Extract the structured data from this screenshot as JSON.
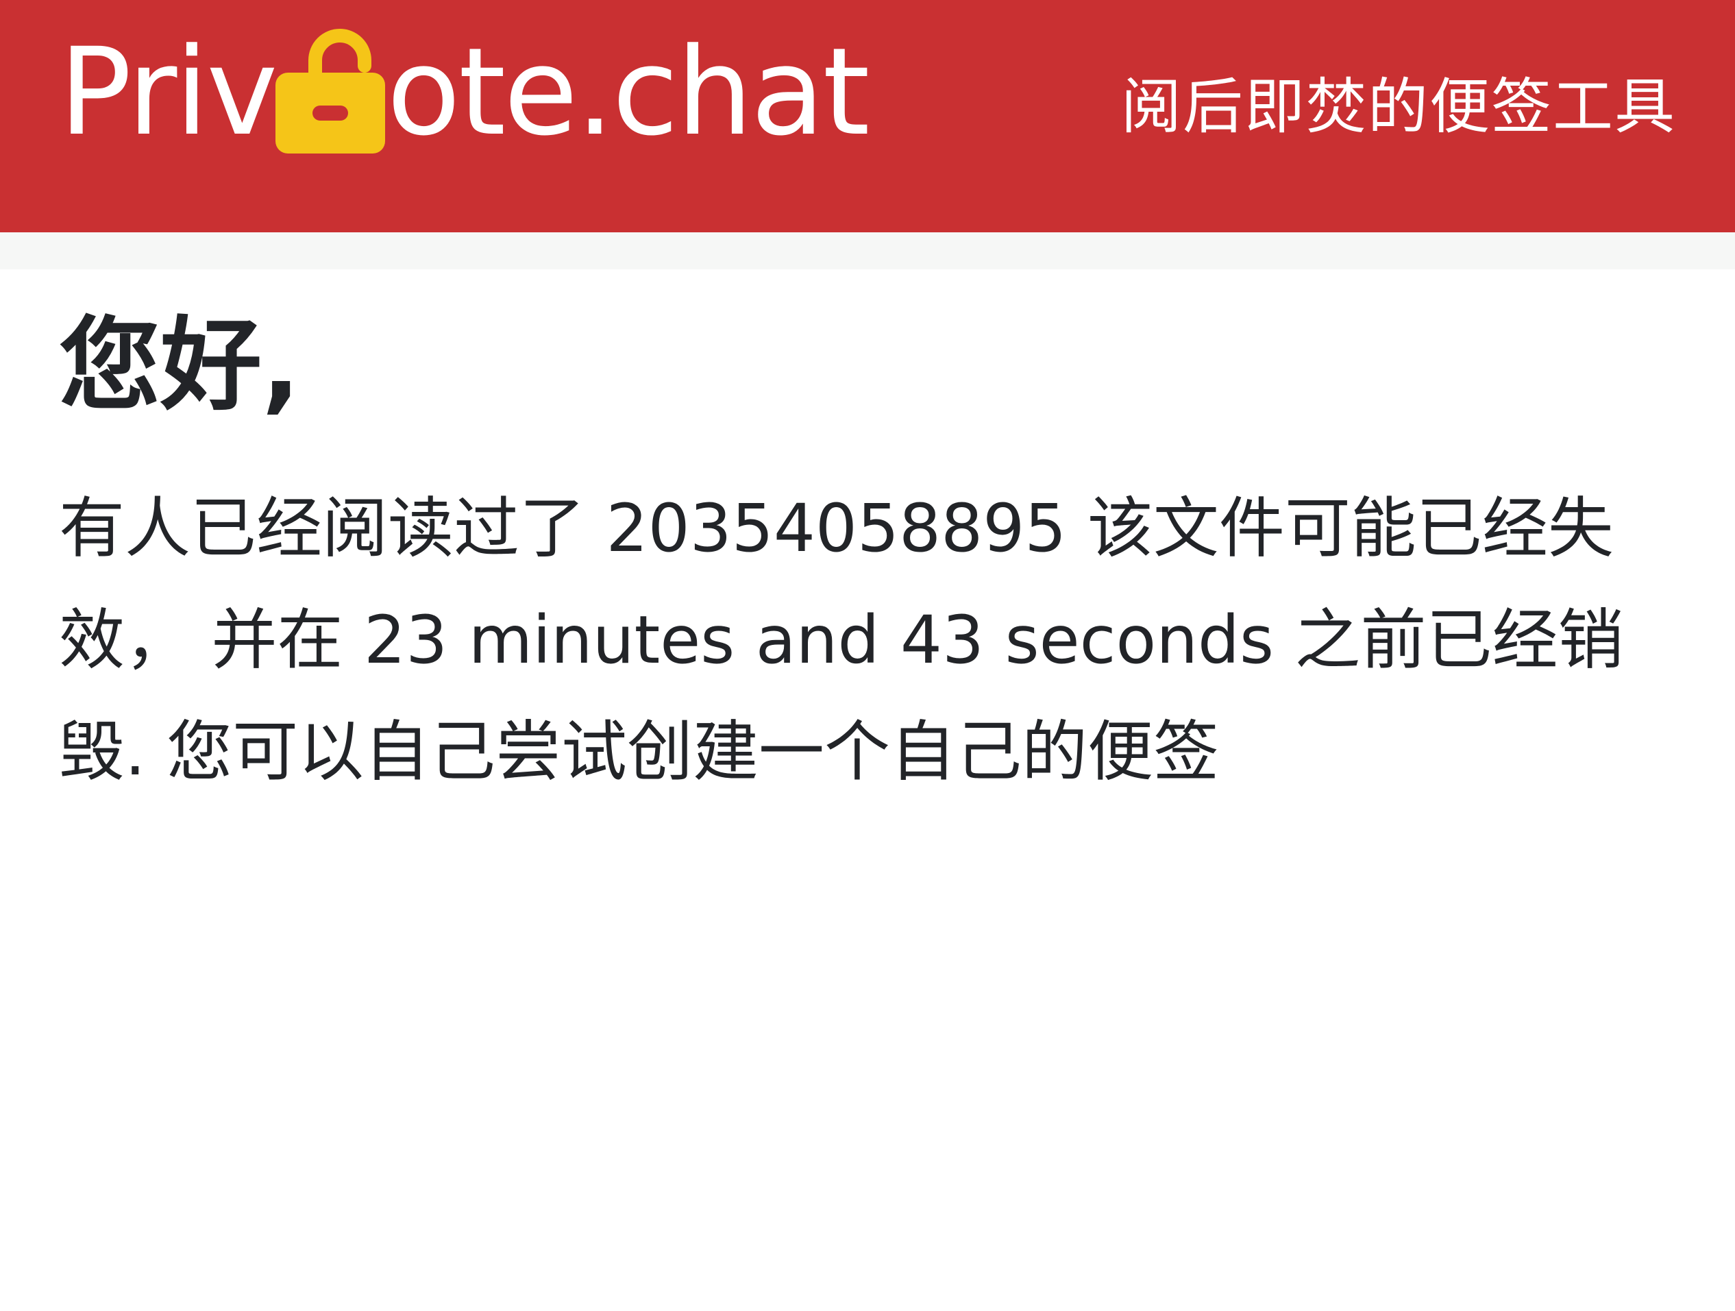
{
  "header": {
    "logo_left": "Priv",
    "logo_right": "ote.chat",
    "logo_icon": "lock-icon",
    "tagline": "阅后即焚的便签工具",
    "colors": {
      "header_bg": "#c93032",
      "lock": "#f5c518",
      "text": "#ffffff"
    }
  },
  "main": {
    "greeting": "您好,",
    "message": "有人已经阅读过了 20354058895 该文件可能已经失效， 并在 23 minutes and 43 seconds 之前已经销毁. 您可以自己尝试创建一个自己的便签"
  }
}
